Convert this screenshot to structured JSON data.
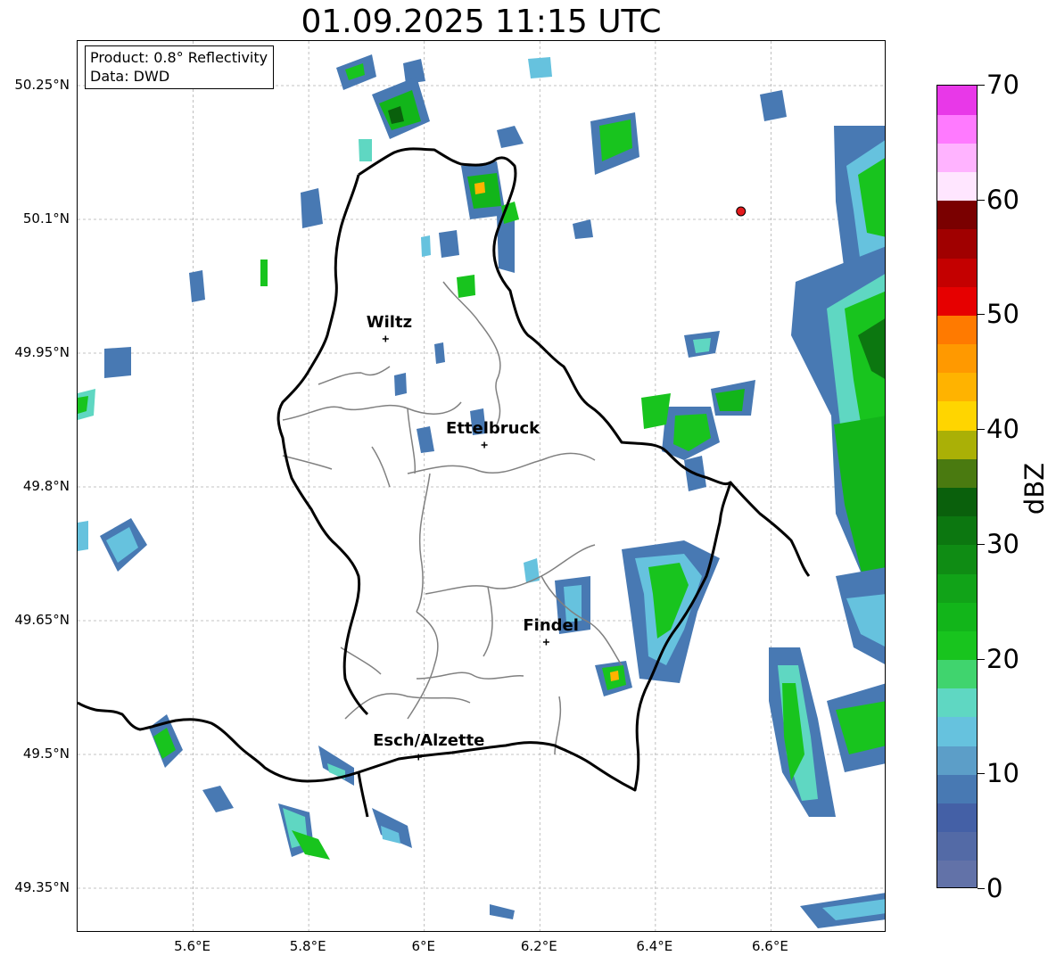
{
  "title": "01.09.2025 11:15 UTC",
  "info": {
    "product": "Product: 0.8° Reflectivity",
    "data": "Data: DWD"
  },
  "axes": {
    "lat_labels": [
      "50.25°N",
      "50.1°N",
      "49.95°N",
      "49.8°N",
      "49.65°N",
      "49.5°N",
      "49.35°N"
    ],
    "lon_labels": [
      "5.6°E",
      "5.8°E",
      "6°E",
      "6.2°E",
      "6.4°E",
      "6.6°E"
    ],
    "lat_values": [
      50.25,
      50.1,
      49.95,
      49.8,
      49.65,
      49.5,
      49.35
    ],
    "lon_values": [
      5.6,
      5.8,
      6.0,
      6.2,
      6.4,
      6.6
    ],
    "lon_range": [
      5.4,
      6.8
    ],
    "lat_range": [
      49.3,
      50.3
    ]
  },
  "cities": [
    {
      "name": "Wiltz",
      "lon": 5.933,
      "lat": 49.966
    },
    {
      "name": "Ettelbruck",
      "lon": 6.104,
      "lat": 49.847
    },
    {
      "name": "Findel",
      "lon": 6.211,
      "lat": 49.626
    },
    {
      "name": "Esch/Alzette",
      "lon": 5.99,
      "lat": 49.497
    }
  ],
  "station": {
    "lon": 6.548,
    "lat": 50.109,
    "color": "#e31a1c"
  },
  "colorbar": {
    "unit": "dBZ",
    "min": 0,
    "max": 70,
    "tick_labels": [
      "70",
      "60",
      "50",
      "40",
      "30",
      "20",
      "10",
      "0"
    ],
    "tick_values": [
      70,
      60,
      50,
      40,
      30,
      20,
      10,
      0
    ],
    "colors": [
      "#6272a8",
      "#536aa6",
      "#4460a6",
      "#4879b3",
      "#5c9ec8",
      "#66c2de",
      "#5fd7c2",
      "#40d46e",
      "#18c41e",
      "#12b51a",
      "#11a318",
      "#0f8c14",
      "#0c7710",
      "#0a600c",
      "#4a7a10",
      "#aab006",
      "#ffd500",
      "#ffb300",
      "#ff9900",
      "#ff7a00",
      "#e60000",
      "#c40000",
      "#a00000",
      "#7a0000",
      "#ffe6ff",
      "#ffb3ff",
      "#ff7aff",
      "#e838e8"
    ]
  }
}
